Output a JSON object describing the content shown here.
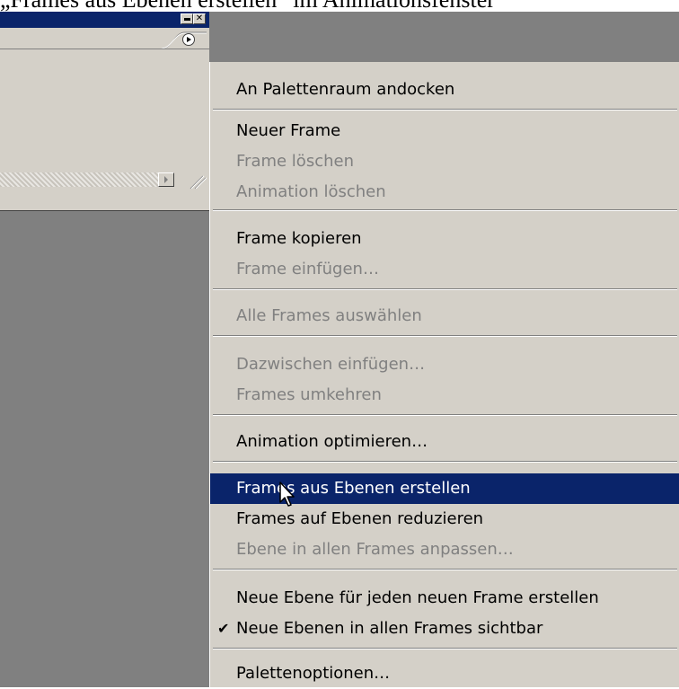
{
  "caption": "„Frames aus Ebenen erstellen“ im Animationsfenster",
  "palette": {
    "minimize_label": "",
    "close_label": "✕"
  },
  "menu": {
    "items": [
      {
        "label": "An Palettenraum andocken",
        "enabled": true
      },
      {
        "label": "Neuer Frame",
        "enabled": true
      },
      {
        "label": "Frame löschen",
        "enabled": false
      },
      {
        "label": "Animation löschen",
        "enabled": false
      },
      {
        "label": "Frame kopieren",
        "enabled": true
      },
      {
        "label": "Frame einfügen…",
        "enabled": false
      },
      {
        "label": "Alle Frames auswählen",
        "enabled": false
      },
      {
        "label": "Dazwischen einfügen…",
        "enabled": false
      },
      {
        "label": "Frames umkehren",
        "enabled": false
      },
      {
        "label": "Animation optimieren…",
        "enabled": true
      },
      {
        "label": "Frames aus Ebenen erstellen",
        "enabled": true,
        "highlighted": true
      },
      {
        "label": "Frames auf Ebenen reduzieren",
        "enabled": true
      },
      {
        "label": "Ebene in allen Frames anpassen…",
        "enabled": false
      },
      {
        "label": "Neue Ebene für jeden neuen Frame erstellen",
        "enabled": true
      },
      {
        "label": "Neue Ebenen in allen Frames sichtbar",
        "enabled": true,
        "checked": true
      },
      {
        "label": "Palettenoptionen…",
        "enabled": true
      }
    ],
    "check_glyph": "✔"
  },
  "colors": {
    "highlight": "#0a246a",
    "menu_bg": "#d4d0c8",
    "disabled_text": "#808080",
    "workspace": "#808080"
  }
}
